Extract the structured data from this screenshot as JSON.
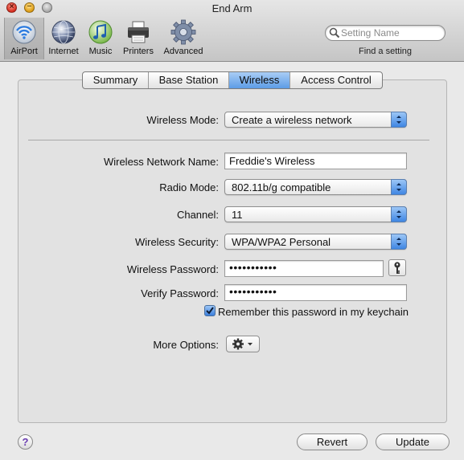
{
  "window": {
    "title": "End Arm"
  },
  "toolbar": {
    "items": [
      {
        "label": "AirPort",
        "icon": "airport-wifi-icon",
        "selected": true
      },
      {
        "label": "Internet",
        "icon": "globe-icon",
        "selected": false
      },
      {
        "label": "Music",
        "icon": "music-note-icon",
        "selected": false
      },
      {
        "label": "Printers",
        "icon": "printer-icon",
        "selected": false
      },
      {
        "label": "Advanced",
        "icon": "gear-icon",
        "selected": false
      }
    ],
    "search_placeholder": "Setting Name",
    "find_label": "Find a setting"
  },
  "tabs": [
    {
      "label": "Summary",
      "active": false
    },
    {
      "label": "Base Station",
      "active": false
    },
    {
      "label": "Wireless",
      "active": true
    },
    {
      "label": "Access Control",
      "active": false
    }
  ],
  "form": {
    "wireless_mode": {
      "label": "Wireless Mode:",
      "value": "Create a wireless network"
    },
    "network_name": {
      "label": "Wireless Network Name:",
      "value": "Freddie's Wireless"
    },
    "radio_mode": {
      "label": "Radio Mode:",
      "value": "802.11b/g compatible"
    },
    "channel": {
      "label": "Channel:",
      "value": "11"
    },
    "security": {
      "label": "Wireless Security:",
      "value": "WPA/WPA2 Personal"
    },
    "password": {
      "label": "Wireless Password:",
      "value": "•••••••••••"
    },
    "verify": {
      "label": "Verify Password:",
      "value": "•••••••••••"
    },
    "remember": {
      "label": "Remember this password in my keychain",
      "checked": true
    },
    "more_options": {
      "label": "More Options:"
    }
  },
  "footer": {
    "help_label": "?",
    "revert_label": "Revert",
    "update_label": "Update"
  },
  "colors": {
    "accent": "#5d9ce6",
    "window_bg": "#e9e9e9"
  }
}
